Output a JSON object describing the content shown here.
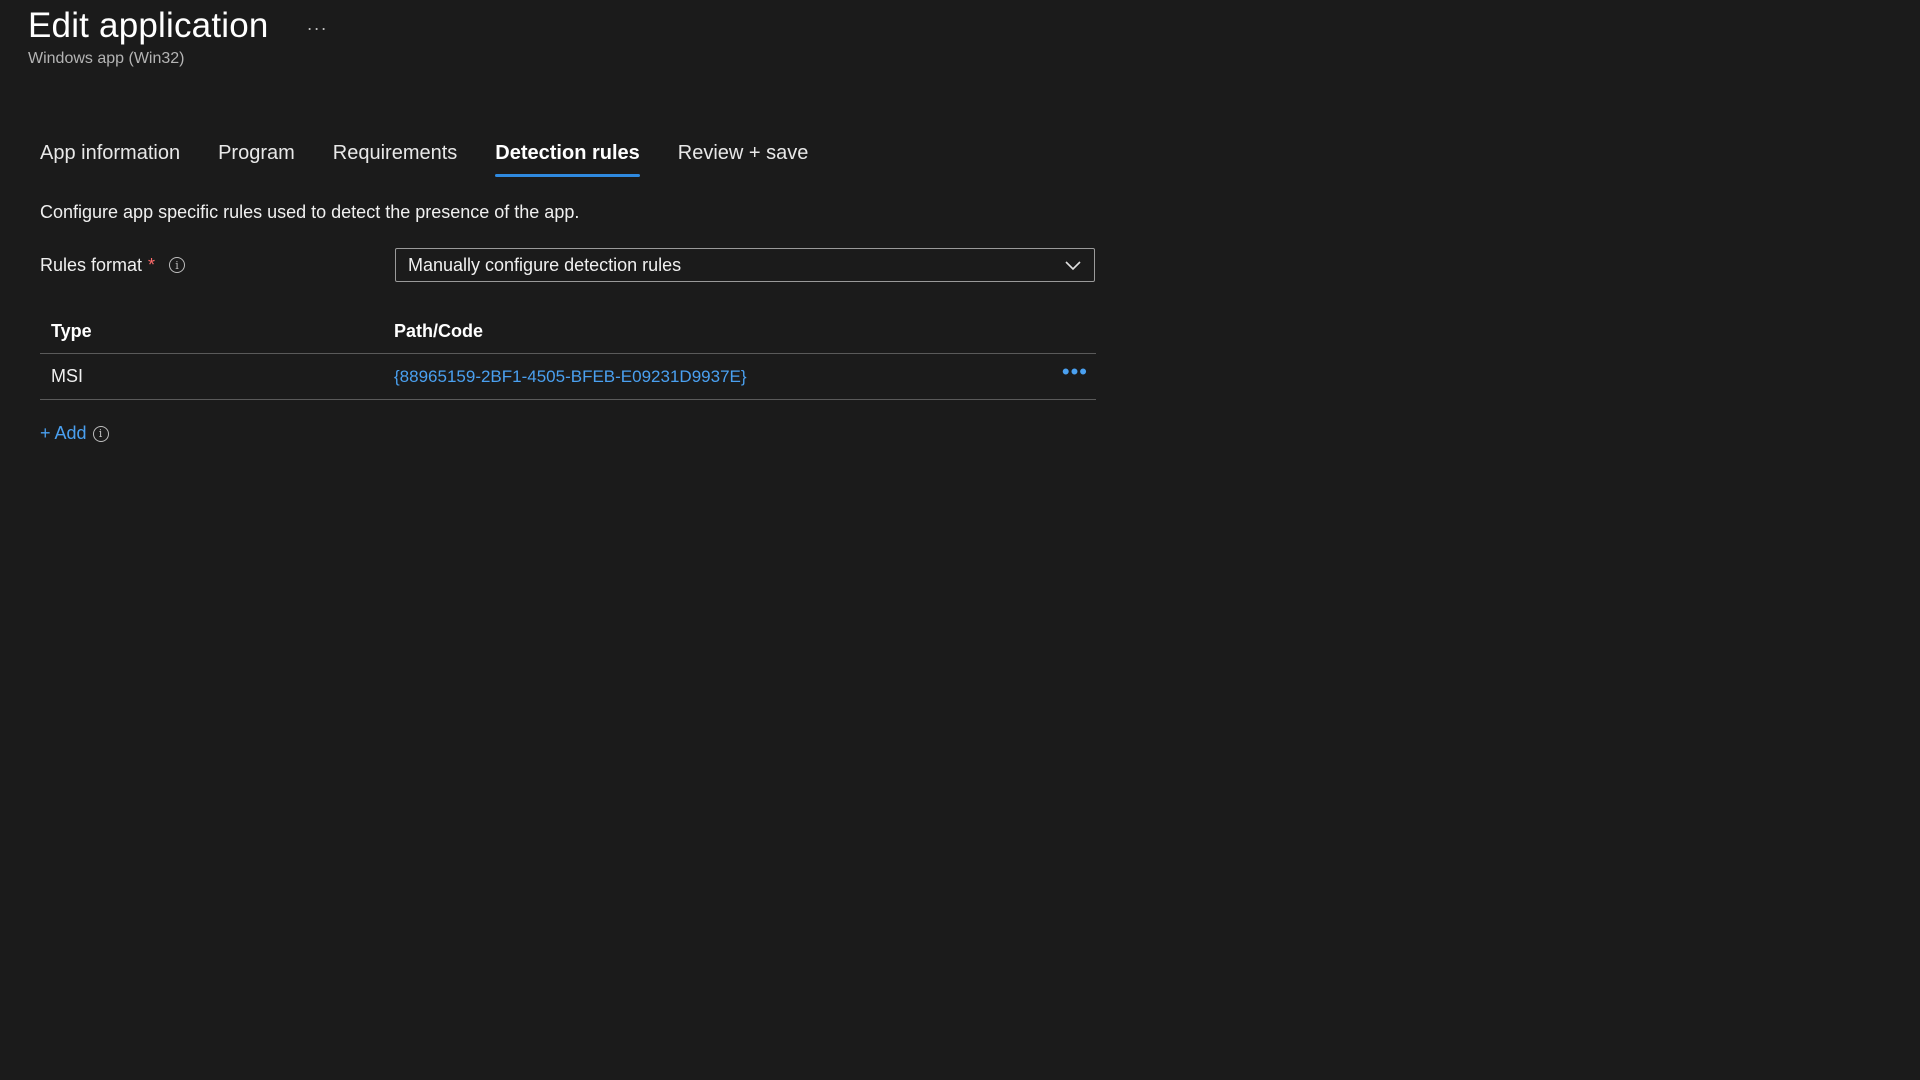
{
  "header": {
    "title": "Edit application",
    "more_label": "···",
    "subtitle": "Windows app (Win32)"
  },
  "tabs": [
    {
      "label": "App information",
      "active": false
    },
    {
      "label": "Program",
      "active": false
    },
    {
      "label": "Requirements",
      "active": false
    },
    {
      "label": "Detection rules",
      "active": true
    },
    {
      "label": "Review + save",
      "active": false
    }
  ],
  "description": "Configure app specific rules used to detect the presence of the app.",
  "rules_format": {
    "label": "Rules format",
    "required_mark": "*",
    "info_glyph": "i",
    "selected_value": "Manually configure detection rules"
  },
  "table": {
    "headers": {
      "type": "Type",
      "path": "Path/Code"
    },
    "rows": [
      {
        "type": "MSI",
        "path": "{88965159-2BF1-4505-BFEB-E09231D9937E}",
        "more": "•••"
      }
    ]
  },
  "add": {
    "label": "+ Add",
    "info_glyph": "i"
  },
  "colors": {
    "background": "#1b1b1b",
    "accent": "#2f8ae0",
    "link": "#4aa0f0",
    "required": "#ff6b6b"
  }
}
